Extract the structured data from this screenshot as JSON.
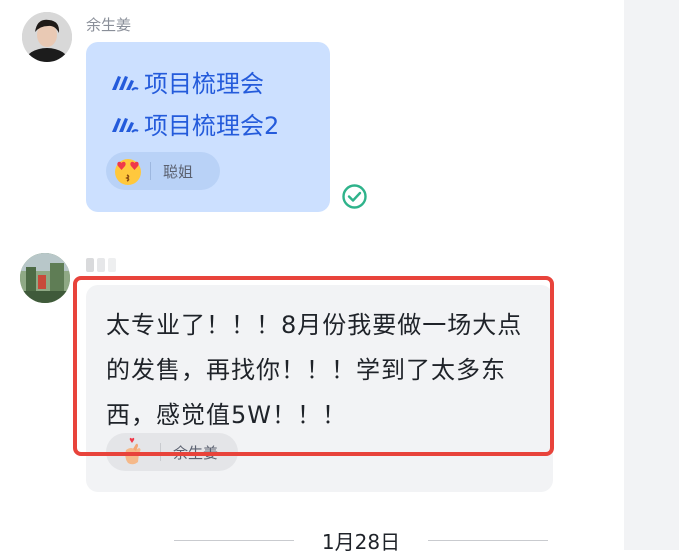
{
  "messages": [
    {
      "sender": "余生姜",
      "links": [
        {
          "icon": "doc-icon",
          "title": "项目梳理会"
        },
        {
          "icon": "doc-icon",
          "title": "项目梳理会2"
        }
      ],
      "reaction": {
        "emoji": "kissing-heart-emoji",
        "reactor": "聪姐"
      },
      "status_icon": "read-check-icon"
    },
    {
      "sender": "",
      "text": "太专业了！！！8月份我要做一场大点的发售，再找你！！！学到了太多东西，感觉值5W！！！",
      "reaction": {
        "emoji": "finger-heart-emoji",
        "reactor": "余生姜"
      },
      "highlight_color": "#e8433b"
    }
  ],
  "date_divider": "1月28日",
  "colors": {
    "own_bubble": "#cce0ff",
    "other_bubble": "#f2f3f5",
    "link": "#245bdb",
    "read_check": "#2fb38b"
  }
}
